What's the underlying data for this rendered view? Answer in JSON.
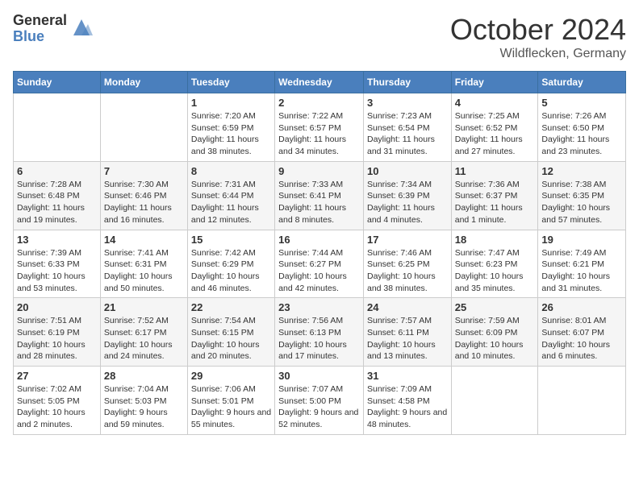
{
  "header": {
    "logo_general": "General",
    "logo_blue": "Blue",
    "month_title": "October 2024",
    "location": "Wildflecken, Germany"
  },
  "weekdays": [
    "Sunday",
    "Monday",
    "Tuesday",
    "Wednesday",
    "Thursday",
    "Friday",
    "Saturday"
  ],
  "weeks": [
    [
      {
        "day": "",
        "info": ""
      },
      {
        "day": "",
        "info": ""
      },
      {
        "day": "1",
        "info": "Sunrise: 7:20 AM\nSunset: 6:59 PM\nDaylight: 11 hours and 38 minutes."
      },
      {
        "day": "2",
        "info": "Sunrise: 7:22 AM\nSunset: 6:57 PM\nDaylight: 11 hours and 34 minutes."
      },
      {
        "day": "3",
        "info": "Sunrise: 7:23 AM\nSunset: 6:54 PM\nDaylight: 11 hours and 31 minutes."
      },
      {
        "day": "4",
        "info": "Sunrise: 7:25 AM\nSunset: 6:52 PM\nDaylight: 11 hours and 27 minutes."
      },
      {
        "day": "5",
        "info": "Sunrise: 7:26 AM\nSunset: 6:50 PM\nDaylight: 11 hours and 23 minutes."
      }
    ],
    [
      {
        "day": "6",
        "info": "Sunrise: 7:28 AM\nSunset: 6:48 PM\nDaylight: 11 hours and 19 minutes."
      },
      {
        "day": "7",
        "info": "Sunrise: 7:30 AM\nSunset: 6:46 PM\nDaylight: 11 hours and 16 minutes."
      },
      {
        "day": "8",
        "info": "Sunrise: 7:31 AM\nSunset: 6:44 PM\nDaylight: 11 hours and 12 minutes."
      },
      {
        "day": "9",
        "info": "Sunrise: 7:33 AM\nSunset: 6:41 PM\nDaylight: 11 hours and 8 minutes."
      },
      {
        "day": "10",
        "info": "Sunrise: 7:34 AM\nSunset: 6:39 PM\nDaylight: 11 hours and 4 minutes."
      },
      {
        "day": "11",
        "info": "Sunrise: 7:36 AM\nSunset: 6:37 PM\nDaylight: 11 hours and 1 minute."
      },
      {
        "day": "12",
        "info": "Sunrise: 7:38 AM\nSunset: 6:35 PM\nDaylight: 10 hours and 57 minutes."
      }
    ],
    [
      {
        "day": "13",
        "info": "Sunrise: 7:39 AM\nSunset: 6:33 PM\nDaylight: 10 hours and 53 minutes."
      },
      {
        "day": "14",
        "info": "Sunrise: 7:41 AM\nSunset: 6:31 PM\nDaylight: 10 hours and 50 minutes."
      },
      {
        "day": "15",
        "info": "Sunrise: 7:42 AM\nSunset: 6:29 PM\nDaylight: 10 hours and 46 minutes."
      },
      {
        "day": "16",
        "info": "Sunrise: 7:44 AM\nSunset: 6:27 PM\nDaylight: 10 hours and 42 minutes."
      },
      {
        "day": "17",
        "info": "Sunrise: 7:46 AM\nSunset: 6:25 PM\nDaylight: 10 hours and 38 minutes."
      },
      {
        "day": "18",
        "info": "Sunrise: 7:47 AM\nSunset: 6:23 PM\nDaylight: 10 hours and 35 minutes."
      },
      {
        "day": "19",
        "info": "Sunrise: 7:49 AM\nSunset: 6:21 PM\nDaylight: 10 hours and 31 minutes."
      }
    ],
    [
      {
        "day": "20",
        "info": "Sunrise: 7:51 AM\nSunset: 6:19 PM\nDaylight: 10 hours and 28 minutes."
      },
      {
        "day": "21",
        "info": "Sunrise: 7:52 AM\nSunset: 6:17 PM\nDaylight: 10 hours and 24 minutes."
      },
      {
        "day": "22",
        "info": "Sunrise: 7:54 AM\nSunset: 6:15 PM\nDaylight: 10 hours and 20 minutes."
      },
      {
        "day": "23",
        "info": "Sunrise: 7:56 AM\nSunset: 6:13 PM\nDaylight: 10 hours and 17 minutes."
      },
      {
        "day": "24",
        "info": "Sunrise: 7:57 AM\nSunset: 6:11 PM\nDaylight: 10 hours and 13 minutes."
      },
      {
        "day": "25",
        "info": "Sunrise: 7:59 AM\nSunset: 6:09 PM\nDaylight: 10 hours and 10 minutes."
      },
      {
        "day": "26",
        "info": "Sunrise: 8:01 AM\nSunset: 6:07 PM\nDaylight: 10 hours and 6 minutes."
      }
    ],
    [
      {
        "day": "27",
        "info": "Sunrise: 7:02 AM\nSunset: 5:05 PM\nDaylight: 10 hours and 2 minutes."
      },
      {
        "day": "28",
        "info": "Sunrise: 7:04 AM\nSunset: 5:03 PM\nDaylight: 9 hours and 59 minutes."
      },
      {
        "day": "29",
        "info": "Sunrise: 7:06 AM\nSunset: 5:01 PM\nDaylight: 9 hours and 55 minutes."
      },
      {
        "day": "30",
        "info": "Sunrise: 7:07 AM\nSunset: 5:00 PM\nDaylight: 9 hours and 52 minutes."
      },
      {
        "day": "31",
        "info": "Sunrise: 7:09 AM\nSunset: 4:58 PM\nDaylight: 9 hours and 48 minutes."
      },
      {
        "day": "",
        "info": ""
      },
      {
        "day": "",
        "info": ""
      }
    ]
  ]
}
